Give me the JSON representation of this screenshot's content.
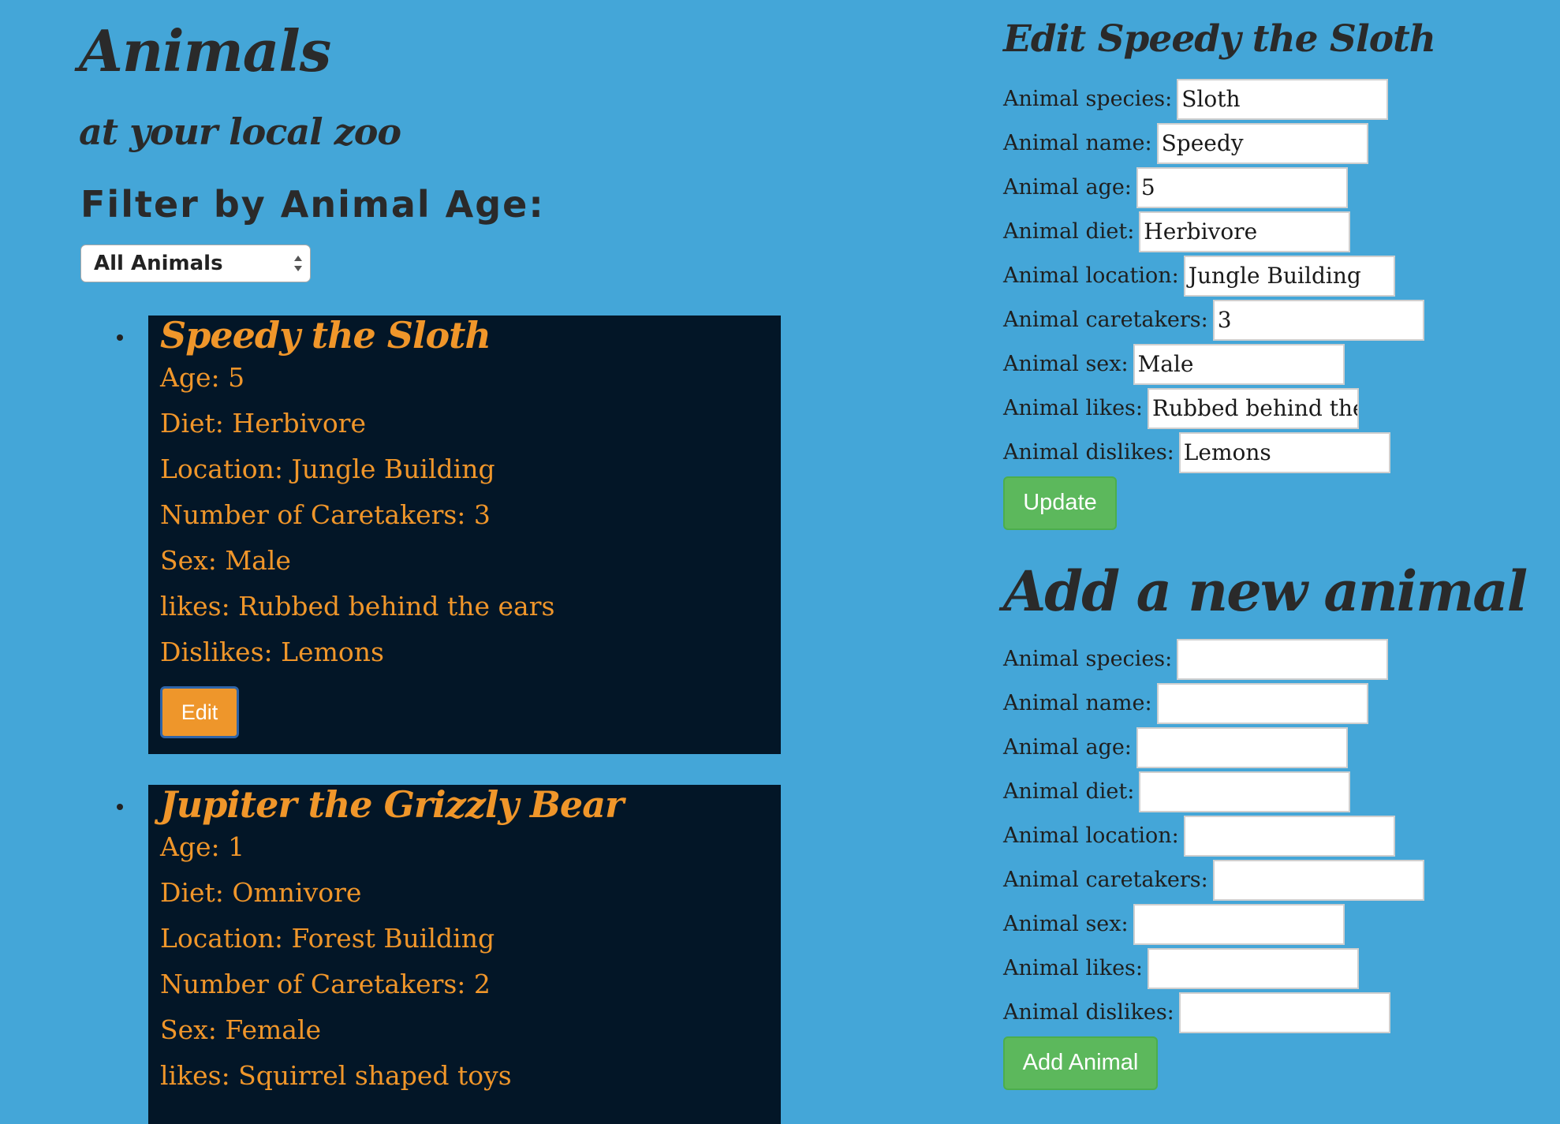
{
  "header": {
    "title": "Animals",
    "subtitle": "at your local zoo"
  },
  "filter": {
    "heading": "Filter by Animal Age:",
    "selected": "All Animals",
    "arrow_icon": "select-arrows-icon"
  },
  "animals": [
    {
      "title": "Speedy the Sloth",
      "age": "Age: 5",
      "diet": "Diet: Herbivore",
      "location": "Location: Jungle Building",
      "caretakers": "Number of Caretakers: 3",
      "sex": "Sex: Male",
      "likes": "likes: Rubbed behind the ears",
      "dislikes": "Dislikes: Lemons",
      "edit_label": "Edit"
    },
    {
      "title": "Jupiter the Grizzly Bear",
      "age": "Age: 1",
      "diet": "Diet: Omnivore",
      "location": "Location: Forest Building",
      "caretakers": "Number of Caretakers: 2",
      "sex": "Sex: Female",
      "likes": "likes: Squirrel shaped toys"
    }
  ],
  "edit_form": {
    "title": "Edit Speedy the Sloth",
    "fields": [
      {
        "label": "Animal species:",
        "value": "Sloth"
      },
      {
        "label": "Animal name:",
        "value": "Speedy"
      },
      {
        "label": "Animal age:",
        "value": "5"
      },
      {
        "label": "Animal diet:",
        "value": "Herbivore"
      },
      {
        "label": "Animal location:",
        "value": "Jungle Building"
      },
      {
        "label": "Animal caretakers:",
        "value": "3"
      },
      {
        "label": "Animal sex:",
        "value": "Male"
      },
      {
        "label": "Animal likes:",
        "value": "Rubbed behind the ea"
      },
      {
        "label": "Animal dislikes:",
        "value": "Lemons"
      }
    ],
    "submit_label": "Update"
  },
  "add_form": {
    "title": "Add a new animal",
    "fields": [
      {
        "label": "Animal species:",
        "value": ""
      },
      {
        "label": "Animal name:",
        "value": ""
      },
      {
        "label": "Animal age:",
        "value": ""
      },
      {
        "label": "Animal diet:",
        "value": ""
      },
      {
        "label": "Animal location:",
        "value": ""
      },
      {
        "label": "Animal caretakers:",
        "value": ""
      },
      {
        "label": "Animal sex:",
        "value": ""
      },
      {
        "label": "Animal likes:",
        "value": ""
      },
      {
        "label": "Animal dislikes:",
        "value": ""
      }
    ],
    "submit_label": "Add Animal"
  },
  "colors": {
    "background": "#44a6d8",
    "card_background": "#031627",
    "card_text": "#f0962a",
    "edit_button": "#ee962b",
    "green_button": "#5cb85c"
  }
}
